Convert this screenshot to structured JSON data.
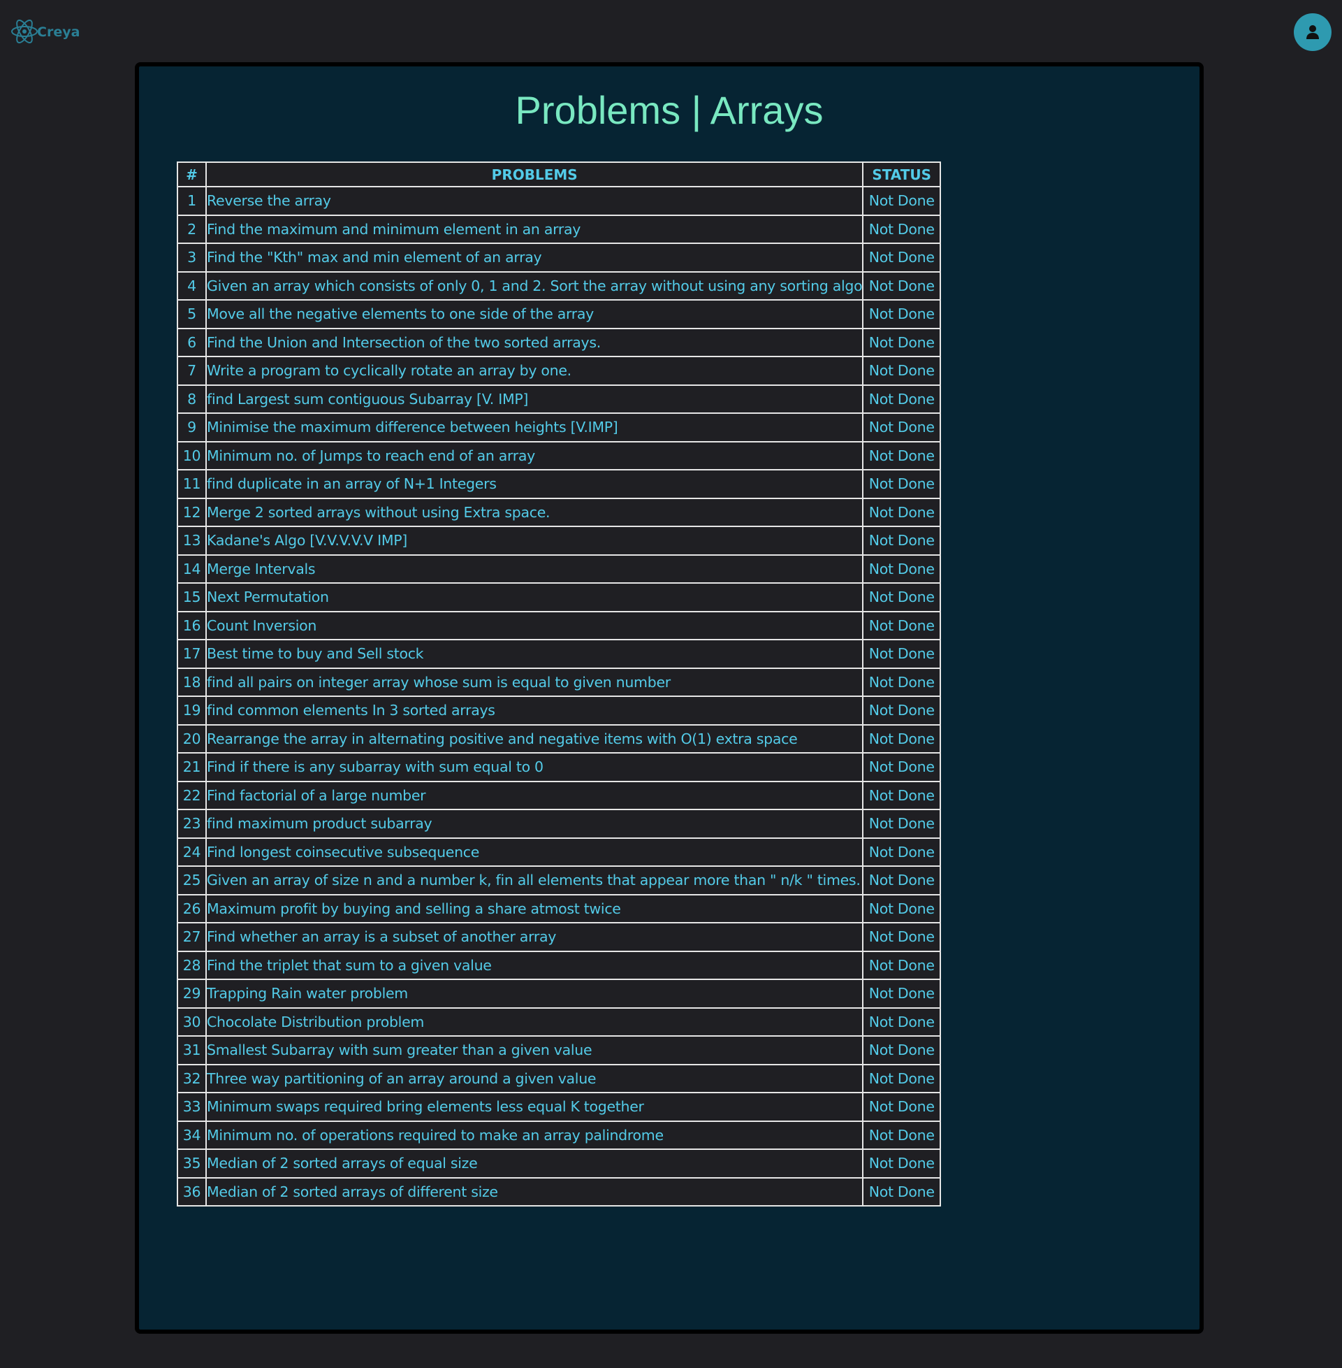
{
  "app": {
    "name": "Creya",
    "logo_icon": "atom-icon",
    "avatar_icon": "user-icon"
  },
  "colors": {
    "background": "#1f1f23",
    "panel": "#062433",
    "title": "#79e8c1",
    "table_text": "#53cbe8",
    "accent": "#2e9ab0"
  },
  "page": {
    "title": "Problems | Arrays"
  },
  "table": {
    "columns": [
      "#",
      "PROBLEMS",
      "STATUS"
    ],
    "rows": [
      {
        "num": "1",
        "problem": "Reverse the array",
        "status": "Not Done"
      },
      {
        "num": "2",
        "problem": "Find the maximum and minimum element in an array",
        "status": "Not Done"
      },
      {
        "num": "3",
        "problem": "Find the \"Kth\" max and min element of an array",
        "status": "Not Done"
      },
      {
        "num": "4",
        "problem": "Given an array which consists of only 0, 1 and 2. Sort the array without using any sorting algo",
        "status": "Not Done"
      },
      {
        "num": "5",
        "problem": "Move all the negative elements to one side of the array",
        "status": "Not Done"
      },
      {
        "num": "6",
        "problem": "Find the Union and Intersection of the two sorted arrays.",
        "status": "Not Done"
      },
      {
        "num": "7",
        "problem": "Write a program to cyclically rotate an array by one.",
        "status": "Not Done"
      },
      {
        "num": "8",
        "problem": "find Largest sum contiguous Subarray [V. IMP]",
        "status": "Not Done"
      },
      {
        "num": "9",
        "problem": "Minimise the maximum difference between heights [V.IMP]",
        "status": "Not Done"
      },
      {
        "num": "10",
        "problem": "Minimum no. of Jumps to reach end of an array",
        "status": "Not Done"
      },
      {
        "num": "11",
        "problem": "find duplicate in an array of N+1 Integers",
        "status": "Not Done"
      },
      {
        "num": "12",
        "problem": "Merge 2 sorted arrays without using Extra space.",
        "status": "Not Done"
      },
      {
        "num": "13",
        "problem": "Kadane's Algo [V.V.V.V.V IMP]",
        "status": "Not Done"
      },
      {
        "num": "14",
        "problem": "Merge Intervals",
        "status": "Not Done"
      },
      {
        "num": "15",
        "problem": "Next Permutation",
        "status": "Not Done"
      },
      {
        "num": "16",
        "problem": "Count Inversion",
        "status": "Not Done"
      },
      {
        "num": "17",
        "problem": "Best time to buy and Sell stock",
        "status": "Not Done"
      },
      {
        "num": "18",
        "problem": "find all pairs on integer array whose sum is equal to given number",
        "status": "Not Done"
      },
      {
        "num": "19",
        "problem": "find common elements In 3 sorted arrays",
        "status": "Not Done"
      },
      {
        "num": "20",
        "problem": "Rearrange the array in alternating positive and negative items with O(1) extra space",
        "status": "Not Done"
      },
      {
        "num": "21",
        "problem": "Find if there is any subarray with sum equal to 0",
        "status": "Not Done"
      },
      {
        "num": "22",
        "problem": "Find factorial of a large number",
        "status": "Not Done"
      },
      {
        "num": "23",
        "problem": "find maximum product subarray",
        "status": "Not Done"
      },
      {
        "num": "24",
        "problem": "Find longest coinsecutive subsequence",
        "status": "Not Done"
      },
      {
        "num": "25",
        "problem": "Given an array of size n and a number k, fin all elements that appear more than \" n/k \" times.",
        "status": "Not Done"
      },
      {
        "num": "26",
        "problem": "Maximum profit by buying and selling a share atmost twice",
        "status": "Not Done"
      },
      {
        "num": "27",
        "problem": "Find whether an array is a subset of another array",
        "status": "Not Done"
      },
      {
        "num": "28",
        "problem": "Find the triplet that sum to a given value",
        "status": "Not Done"
      },
      {
        "num": "29",
        "problem": "Trapping Rain water problem",
        "status": "Not Done"
      },
      {
        "num": "30",
        "problem": "Chocolate Distribution problem",
        "status": "Not Done"
      },
      {
        "num": "31",
        "problem": "Smallest Subarray with sum greater than a given value",
        "status": "Not Done"
      },
      {
        "num": "32",
        "problem": "Three way partitioning of an array around a given value",
        "status": "Not Done"
      },
      {
        "num": "33",
        "problem": "Minimum swaps required bring elements less equal K together",
        "status": "Not Done"
      },
      {
        "num": "34",
        "problem": "Minimum no. of operations required to make an array palindrome",
        "status": "Not Done"
      },
      {
        "num": "35",
        "problem": "Median of 2 sorted arrays of equal size",
        "status": "Not Done"
      },
      {
        "num": "36",
        "problem": "Median of 2 sorted arrays of different size",
        "status": "Not Done"
      }
    ]
  }
}
